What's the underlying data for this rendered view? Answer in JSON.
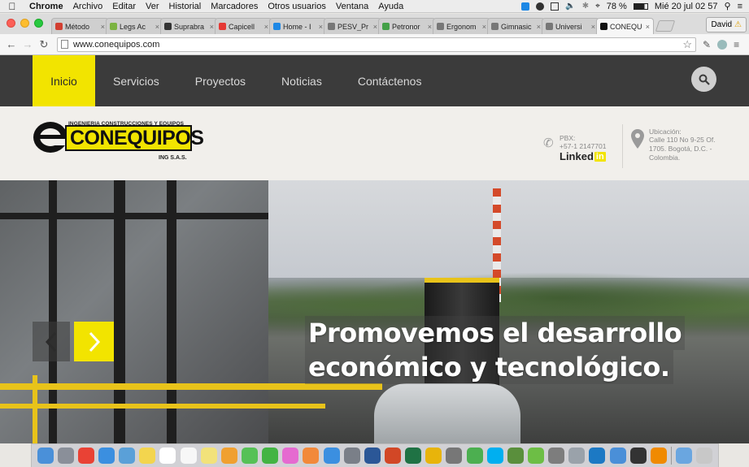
{
  "menubar": {
    "app_name": "Chrome",
    "items": [
      "Archivo",
      "Editar",
      "Ver",
      "Historial",
      "Marcadores",
      "Otros usuarios",
      "Ventana",
      "Ayuda"
    ],
    "battery": "78 %",
    "datetime": "Mié 20 jul  02 57"
  },
  "tabs": [
    {
      "label": "Método",
      "color": "#d23f31"
    },
    {
      "label": "Legs Ac",
      "color": "#7cb342"
    },
    {
      "label": "Suprabra",
      "color": "#333333"
    },
    {
      "label": "Capicell",
      "color": "#e53935"
    },
    {
      "label": "Home - I",
      "color": "#1e88e5"
    },
    {
      "label": "PESV_Pr",
      "color": "#777777"
    },
    {
      "label": "Petronor",
      "color": "#43a047"
    },
    {
      "label": "Ergonom",
      "color": "#777777"
    },
    {
      "label": "Gimnasic",
      "color": "#777777"
    },
    {
      "label": "Universi",
      "color": "#777777"
    },
    {
      "label": "CONEQU",
      "color": "#111111"
    }
  ],
  "tab_close": "×",
  "profile": {
    "name": "David",
    "warn": "⚠"
  },
  "toolbar": {
    "url": "www.conequipos.com",
    "back": "←",
    "forward": "→",
    "reload": "↻",
    "star": "☆"
  },
  "site": {
    "nav": [
      "Inicio",
      "Servicios",
      "Proyectos",
      "Noticias",
      "Contáctenos"
    ],
    "logo": {
      "tagline": "INGENIERIA CONSTRUCCIONES Y EQUIPOS",
      "brand": "CONEQUIPOS",
      "sub": "ING S.A.S."
    },
    "contact": {
      "pbx_label": "PBX:",
      "pbx_number": "+57-1 2147701",
      "linkedin_text": "Linked",
      "linkedin_in": "in",
      "address_label": "Ubicación:",
      "address": "Calle 110 No 9-25 Of. 1705. Bogotá, D.C. - Colombia."
    },
    "hero": {
      "slogan_line1": "Promovemos el desarrollo",
      "slogan_line2": "económico y tecnológico.",
      "prev": "‹",
      "next": "›"
    }
  },
  "dock_apps": [
    "finder",
    "launchpad",
    "chrome",
    "safari",
    "preview",
    "notes",
    "calendar",
    "reminders",
    "stickies",
    "photos",
    "messages",
    "facetime",
    "itunes",
    "ibooks",
    "app-store",
    "system-preferences",
    "word",
    "powerpoint",
    "excel",
    "vlc-like",
    "scrivener",
    "utorrent",
    "skype",
    "grapher",
    "evernote",
    "sublime",
    "disk-utility",
    "teamviewer",
    "bluetooth",
    "terminal",
    "vlc",
    "downloads",
    "trash"
  ]
}
